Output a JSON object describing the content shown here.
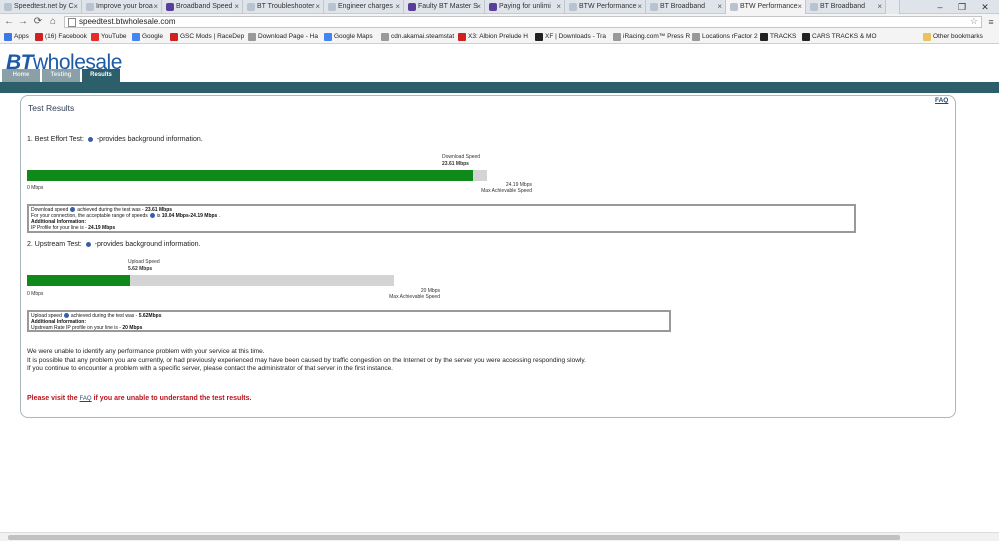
{
  "browser": {
    "tabs": [
      {
        "title": "Speedtest.net by C",
        "icon": "globe-icon"
      },
      {
        "title": "Improve your broa",
        "icon": "page-icon"
      },
      {
        "title": "Broadband Speed",
        "icon": "bt-icon"
      },
      {
        "title": "BT Troubleshooter",
        "icon": "page-icon"
      },
      {
        "title": "Engineer charges",
        "icon": "page-icon"
      },
      {
        "title": "Faulty BT Master S",
        "icon": "bt-icon"
      },
      {
        "title": "Paying for unlimi",
        "icon": "bt-icon"
      },
      {
        "title": "BTW Performance",
        "icon": "page-icon"
      },
      {
        "title": "BT Broadband",
        "icon": "page-icon"
      },
      {
        "title": "BTW Performance",
        "icon": "page-icon"
      },
      {
        "title": "BT Broadband",
        "icon": "page-icon"
      }
    ],
    "active_tab": 9,
    "url": "speedtest.btwholesale.com",
    "window_controls": {
      "minimize": "–",
      "maximize": "❐",
      "close": "✕"
    },
    "bookmarks": [
      {
        "label": "Apps",
        "icon": "apps-grid-icon"
      },
      {
        "label": "(16) Facebook",
        "icon": "facebook-icon"
      },
      {
        "label": "YouTube",
        "icon": "youtube-icon"
      },
      {
        "label": "Google",
        "icon": "google-icon"
      },
      {
        "label": "GSC Mods | RaceDep",
        "icon": "gsc-icon"
      },
      {
        "label": "Download Page - Ha",
        "icon": "page-icon"
      },
      {
        "label": "Google Maps",
        "icon": "maps-icon"
      },
      {
        "label": "cdn.akamai.steamstat",
        "icon": "page-icon"
      },
      {
        "label": "X3: Albion Prelude H",
        "icon": "x3-icon"
      },
      {
        "label": "XF | Downloads - Tra",
        "icon": "xf-icon"
      },
      {
        "label": "iRacing.com™ Press R",
        "icon": "iracing-icon"
      },
      {
        "label": "Locations rFactor 2",
        "icon": "rfactor-icon"
      },
      {
        "label": "TRACKS",
        "icon": "tracks-icon"
      },
      {
        "label": "CARS TRACKS & MO",
        "icon": "tracks-icon"
      },
      {
        "label": "Other bookmarks",
        "icon": "folder-icon"
      }
    ]
  },
  "site": {
    "logo_bt": "BT",
    "logo_rest": "wholesale",
    "nav": [
      {
        "label": "Home"
      },
      {
        "label": "Testing"
      },
      {
        "label": "Results"
      }
    ],
    "active_nav": 2,
    "faq_link": "FAQ",
    "results_title": "Test Results"
  },
  "download_test": {
    "heading_prefix": "1. Best Effort Test:",
    "heading_suffix": "-provides background information.",
    "speed_label": "Download Speed",
    "speed_value": "23.61 Mbps",
    "fill_fraction": 0.9706,
    "scale_min": "0 Mbps",
    "scale_max_value": "24.19 Mbps",
    "scale_max_label": "Max Achievable Speed",
    "box": {
      "line1_prefix": "Download speed",
      "line1_mid": "achieved during the test was -",
      "line1_value": "23.61 Mbps",
      "line2_prefix": "For your connection, the acceptable range of speeds",
      "line2_mid": "is",
      "line2_value": "10.04 Mbps-24.19 Mbps",
      "line2_suffix": ".",
      "line3": "Additional Information:",
      "line4_prefix": "IP Profile for your line is -",
      "line4_value": "24.19 Mbps"
    }
  },
  "upload_test": {
    "heading_prefix": "2. Upstream Test:",
    "heading_suffix": "-provides background information.",
    "speed_label": "Upload Speed",
    "speed_value": "5.62 Mbps",
    "fill_fraction": 0.281,
    "scale_min": "0 Mbps",
    "scale_max_value": "20 Mbps",
    "scale_max_label": "Max Achievable Speed",
    "box": {
      "line1_prefix": "Upload speed",
      "line1_mid": "achieved during the test was -",
      "line1_value": "5.62Mbps",
      "line2": "Additional Information:",
      "line3_prefix": "Upstream Rate IP profile on your line is -",
      "line3_value": "20 Mbps"
    }
  },
  "messages": [
    "We were unable to identify any performance problem with your service at this time.",
    "It is possible that any problem you are currently, or had previously experienced may have been caused by traffic congestion on the Internet or by the server you were accessing responding slowly.",
    "If you continue to encounter a problem with a specific server, please contact the administrator of that server in the first instance."
  ],
  "faq_prompt": {
    "prefix": "Please visit the",
    "link": "FAQ",
    "suffix": "if you are unable to understand the test results."
  },
  "colors": {
    "brand_blue": "#1c5aa6",
    "teal": "#2c5f6a",
    "bar_green": "#0f8a1a",
    "alert_red": "#b8141c"
  }
}
